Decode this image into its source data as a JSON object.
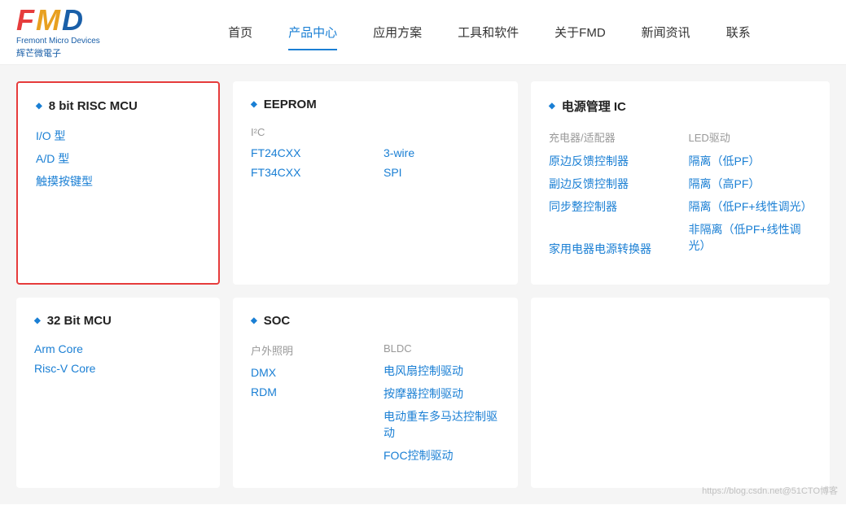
{
  "header": {
    "logo_fmd": "FMD",
    "logo_sub": "Fremont Micro Devices",
    "logo_cn": "辉芒微電子",
    "nav_items": [
      {
        "label": "首页",
        "active": false
      },
      {
        "label": "产品中心",
        "active": true
      },
      {
        "label": "应用方案",
        "active": false
      },
      {
        "label": "工具和软件",
        "active": false
      },
      {
        "label": "关于FMD",
        "active": false
      },
      {
        "label": "新闻资讯",
        "active": false
      },
      {
        "label": "联系",
        "active": false
      }
    ]
  },
  "cards_row1": [
    {
      "id": "card-8bit",
      "title": "8 bit RISC MCU",
      "highlighted": true,
      "type": "single-col",
      "links": [
        "I/O 型",
        "A/D 型",
        "触摸按键型"
      ]
    },
    {
      "id": "card-eeprom",
      "title": "EEPROM",
      "highlighted": false,
      "type": "two-col",
      "col1_header": "I²C",
      "col1_links": [
        "FT24CXX",
        "FT34CXX"
      ],
      "col2_header": "",
      "col2_links": [
        "3-wire",
        "SPI"
      ]
    },
    {
      "id": "card-power",
      "title": "电源管理 IC",
      "highlighted": false,
      "type": "two-col-sections",
      "section1_header": "充电器/适配器",
      "section1_links": [
        "原边反馈控制器",
        "副边反馈控制器",
        "同步整控制器"
      ],
      "section2_header": "LED驱动",
      "section2_links": [
        "隔离（低PF）",
        "隔离（高PF）",
        "隔离（低PF+线性调光）",
        "非隔离（低PF+线性调光）"
      ],
      "section3_header": "家用电器电源转换器",
      "section3_links": []
    }
  ],
  "cards_row2": [
    {
      "id": "card-32bit",
      "title": "32 Bit MCU",
      "type": "single-col",
      "links": [
        "Arm Core",
        "Risc-V Core"
      ]
    },
    {
      "id": "card-soc",
      "title": "SOC",
      "type": "two-col",
      "col1_header": "户外照明",
      "col1_links": [
        "DMX",
        "RDM"
      ],
      "col2_header": "BLDC",
      "col2_links": [
        "电风扇控制驱动",
        "按摩器控制驱动",
        "电动重车多马达控制驱动",
        "FOC控制驱动"
      ]
    }
  ],
  "watermark": "https://blog.csdn.net@51CTO博客"
}
